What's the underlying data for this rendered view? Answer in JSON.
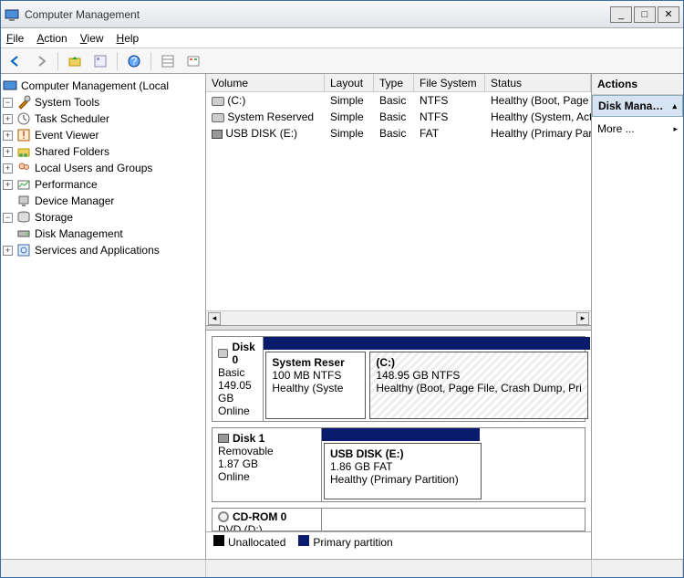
{
  "title": "Computer Management",
  "menu": {
    "file": "File",
    "action": "Action",
    "view": "View",
    "help": "Help"
  },
  "tree": {
    "root": "Computer Management (Local",
    "systools": "System Tools",
    "task": "Task Scheduler",
    "event": "Event Viewer",
    "shared": "Shared Folders",
    "users": "Local Users and Groups",
    "perf": "Performance",
    "devmgr": "Device Manager",
    "storage": "Storage",
    "diskmgmt": "Disk Management",
    "services": "Services and Applications"
  },
  "columns": {
    "vol": "Volume",
    "lay": "Layout",
    "typ": "Type",
    "fs": "File System",
    "st": "Status"
  },
  "volumes": [
    {
      "name": "(C:)",
      "layout": "Simple",
      "type": "Basic",
      "fs": "NTFS",
      "status": "Healthy (Boot, Page File, Crash D"
    },
    {
      "name": "System Reserved",
      "layout": "Simple",
      "type": "Basic",
      "fs": "NTFS",
      "status": "Healthy (System, Active, Primary"
    },
    {
      "name": "USB DISK (E:)",
      "layout": "Simple",
      "type": "Basic",
      "fs": "FAT",
      "status": "Healthy (Primary Partition)"
    }
  ],
  "disks": [
    {
      "title": "Disk 0",
      "type": "Basic",
      "size": "149.05 GB",
      "state": "Online",
      "parts": [
        {
          "title": "System Reser",
          "l2": "100 MB NTFS",
          "l3": "Healthy (Syste"
        },
        {
          "title": "(C:)",
          "l2": "148.95 GB NTFS",
          "l3": "Healthy (Boot, Page File, Crash Dump, Pri"
        }
      ]
    },
    {
      "title": "Disk 1",
      "type": "Removable",
      "size": "1.87 GB",
      "state": "Online",
      "parts": [
        {
          "title": "USB DISK  (E:)",
          "l2": "1.86 GB FAT",
          "l3": "Healthy (Primary Partition)"
        }
      ]
    }
  ],
  "cdrom": {
    "title": "CD-ROM 0",
    "sub": "DVD (D:)"
  },
  "legend": {
    "unalloc": "Unallocated",
    "primary": "Primary partition"
  },
  "actions": {
    "header": "Actions",
    "selected": "Disk Mana…",
    "more": "More ..."
  }
}
